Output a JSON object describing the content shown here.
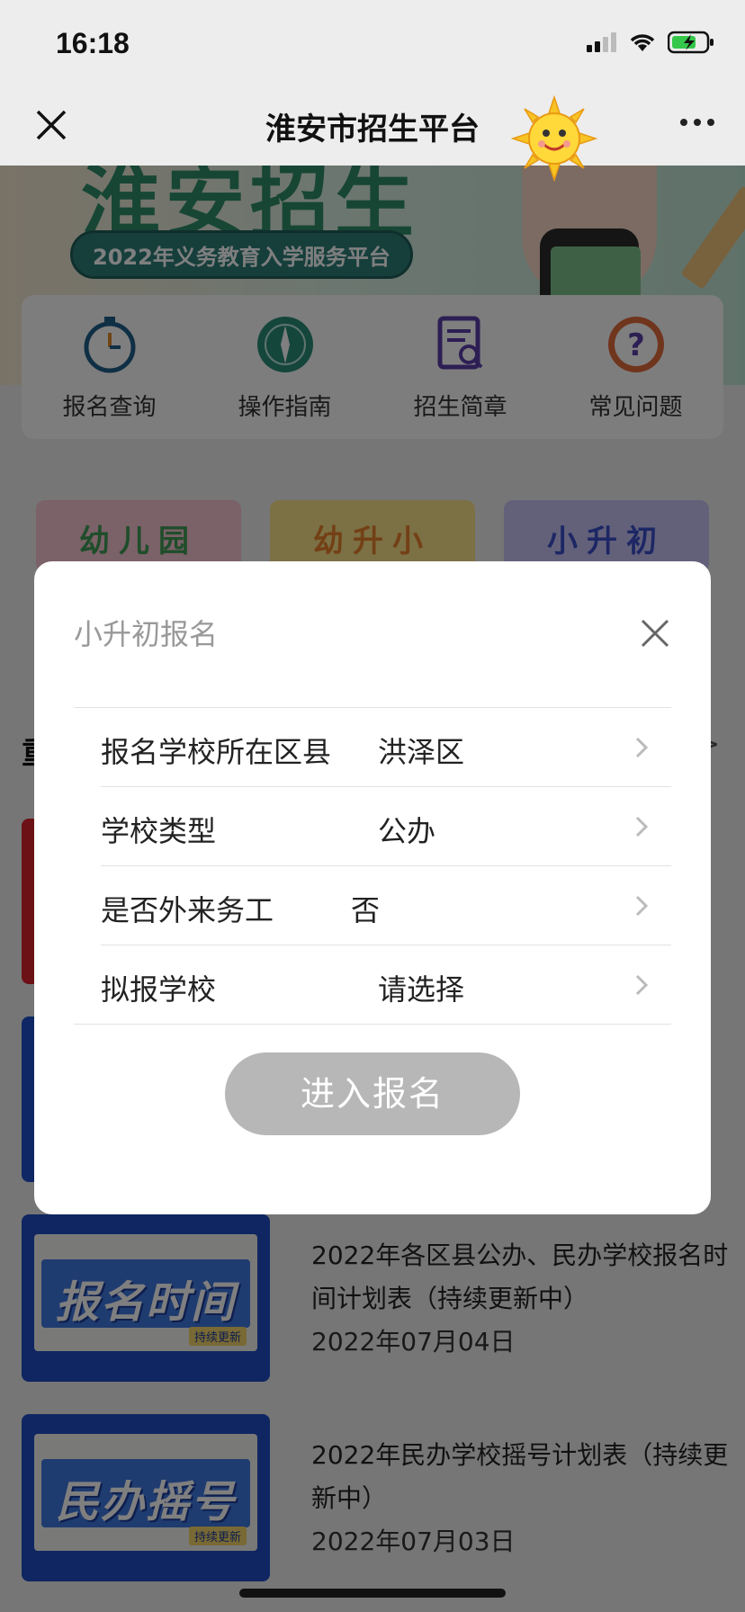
{
  "status": {
    "time": "16:18"
  },
  "nav": {
    "title": "淮安市招生平台"
  },
  "banner": {
    "headline": "淮安招生",
    "subtitle": "2022年义务教育入学服务平台"
  },
  "quick_links": [
    {
      "label": "报名查询",
      "icon": "stopwatch-icon"
    },
    {
      "label": "操作指南",
      "icon": "compass-icon"
    },
    {
      "label": "招生简章",
      "icon": "document-search-icon"
    },
    {
      "label": "常见问题",
      "icon": "question-icon"
    }
  ],
  "levels": [
    "幼儿园",
    "幼升小",
    "小升初"
  ],
  "section": {
    "title_partial": "重",
    "more": ">"
  },
  "news": [
    {
      "thumb_text": "报名时间",
      "thumb_tag": "持续更新",
      "title": "2022年各区县公办、民办学校报名时间计划表（持续更新中）",
      "date": "2022年07月04日"
    },
    {
      "thumb_text": "民办摇号",
      "thumb_tag": "持续更新",
      "title": "2022年民办学校摇号计划表（持续更新中）",
      "date": "2022年07月03日"
    }
  ],
  "modal": {
    "title": "小升初报名",
    "rows": [
      {
        "label": "报名学校所在区县",
        "value": "洪泽区"
      },
      {
        "label": "学校类型",
        "value": "公办"
      },
      {
        "label": "是否外来务工",
        "value": "否"
      },
      {
        "label": "拟报学校",
        "value": "请选择"
      }
    ],
    "button": "进入报名"
  }
}
